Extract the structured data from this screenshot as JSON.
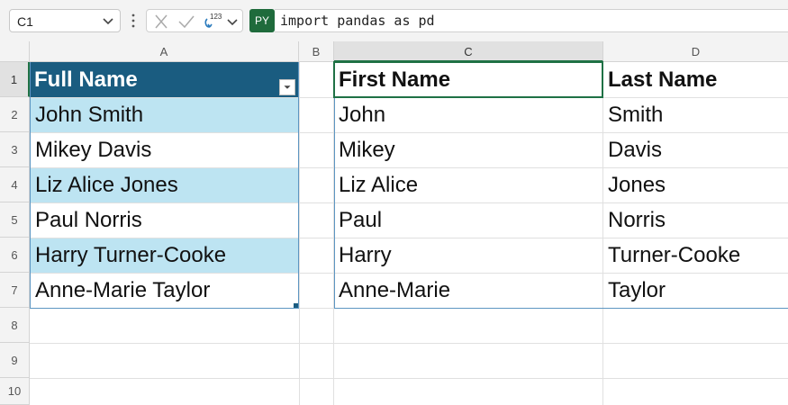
{
  "formula_bar": {
    "name_box": "C1",
    "type_badge": "123",
    "formula_mode": "PY",
    "formula": "import pandas as pd"
  },
  "columns": [
    "A",
    "B",
    "C",
    "D"
  ],
  "rows": [
    "1",
    "2",
    "3",
    "4",
    "5",
    "6",
    "7",
    "8",
    "9",
    "10"
  ],
  "table_full_name": {
    "header": "Full Name",
    "cells": [
      "John Smith",
      "Mikey Davis",
      "Liz Alice Jones",
      "Paul Norris",
      "Harry Turner-Cooke",
      "Anne-Marie Taylor"
    ]
  },
  "python_output": {
    "headers": [
      "First Name",
      "Last Name"
    ],
    "first_names": [
      "John",
      "Mikey",
      "Liz Alice",
      "Paul",
      "Harry",
      "Anne-Marie"
    ],
    "last_names": [
      "Smith",
      "Davis",
      "Jones",
      "Norris",
      "Turner-Cooke",
      "Taylor"
    ]
  },
  "colors": {
    "table_header": "#1a5c80",
    "table_band": "#bde4f2",
    "selection": "#1f7145",
    "python_badge": "#1f6b3c"
  }
}
